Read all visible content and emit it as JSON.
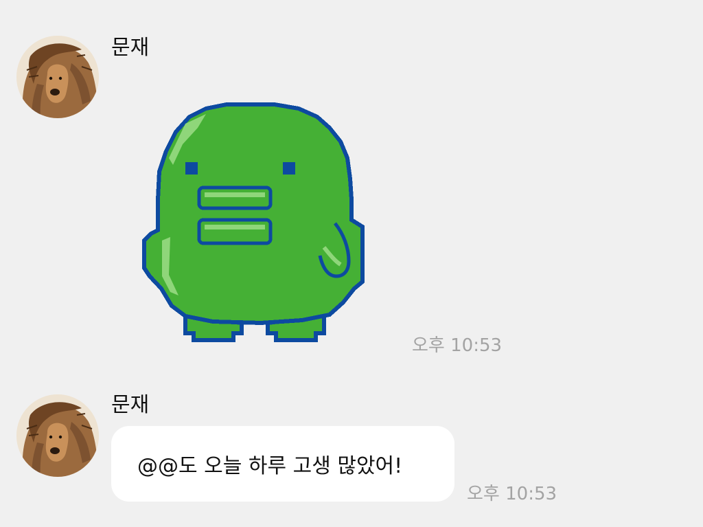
{
  "messages": [
    {
      "sender": "문재",
      "type": "emoticon",
      "emoticon": "green-pixel-bird-icon",
      "time": "오후 10:53"
    },
    {
      "sender": "문재",
      "type": "text",
      "text": "@@도 오늘 하루 고생 많았어!",
      "time": "오후 10:53"
    }
  ],
  "colors": {
    "background": "#f0f0f0",
    "bubble": "#ffffff",
    "emoticon_body": "#45b035",
    "emoticon_outline": "#0d4aa0",
    "timestamp": "#a3a3a3"
  }
}
